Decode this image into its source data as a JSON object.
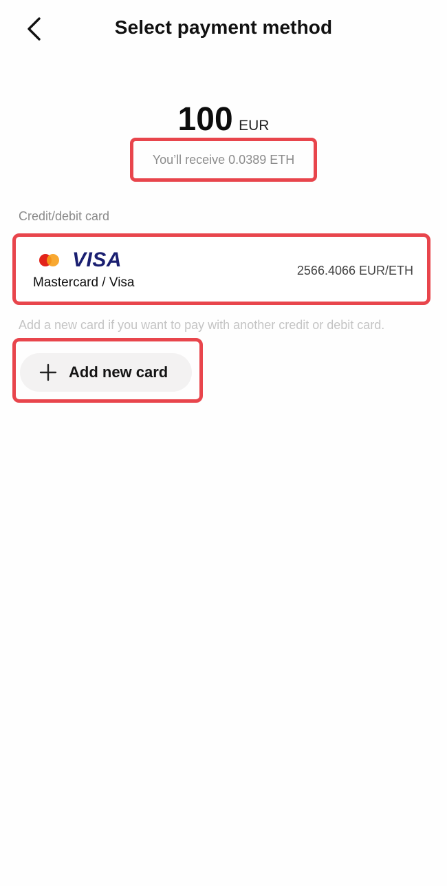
{
  "header": {
    "title": "Select payment method",
    "back_icon": "chevron-left-icon"
  },
  "amount": {
    "value": "100",
    "currency": "EUR",
    "receive_text": "You’ll receive 0.0389 ETH"
  },
  "payment": {
    "section_label": "Credit/debit card",
    "card": {
      "logos": [
        "mastercard-logo",
        "visa-logo"
      ],
      "visa_text": "VISA",
      "name": "Mastercard / Visa",
      "rate": "2566.4066 EUR/ETH"
    },
    "hint": "Add a new card if you want to pay with another credit or debit card.",
    "add_button_label": "Add new card"
  },
  "colors": {
    "highlight": "#e8454c",
    "mastercard_red": "#e2231a",
    "mastercard_orange": "#f79e1b",
    "visa_blue": "#1a1f71"
  }
}
